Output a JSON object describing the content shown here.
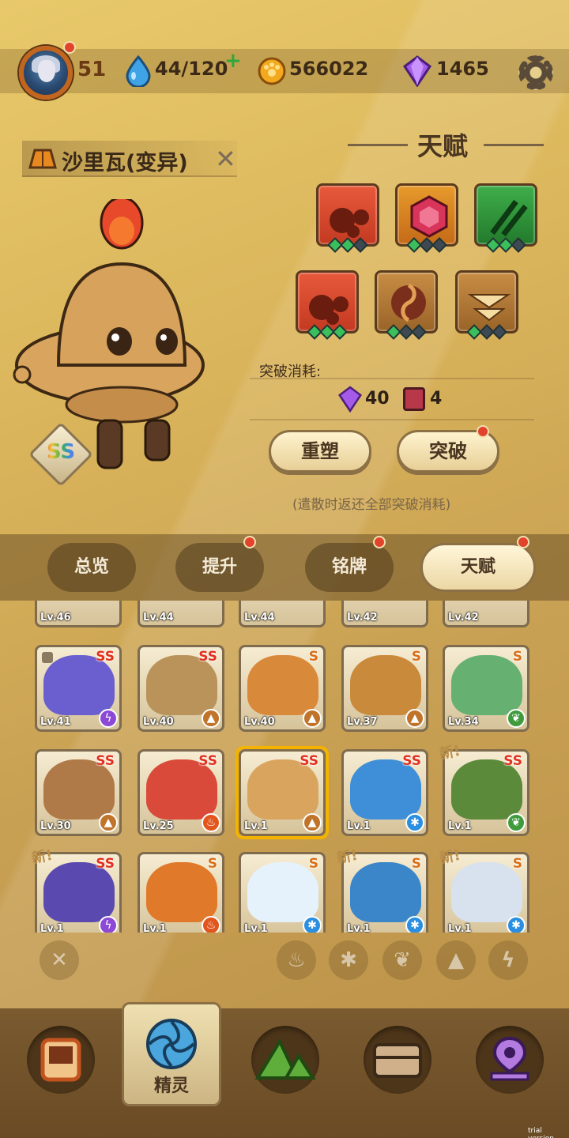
{
  "status": {
    "level": "51",
    "stamina": "44/120",
    "coins": "566022",
    "gems": "1465"
  },
  "spirit": {
    "name": "沙里瓦(变异)",
    "rank": "SS"
  },
  "talent": {
    "title": "天赋",
    "break_cost_label": "突破消耗:",
    "cost_gems": "40",
    "cost_items": "4",
    "reshape_label": "重塑",
    "breakthrough_label": "突破",
    "note": "(遣散时返还全部突破消耗)"
  },
  "tabs": [
    "总览",
    "提升",
    "铭牌",
    "天赋"
  ],
  "cards": [
    {
      "lv": "Lv.41",
      "rank": "SS",
      "element": "thunder"
    },
    {
      "lv": "Lv.40",
      "rank": "SS",
      "element": "earth"
    },
    {
      "lv": "Lv.40",
      "rank": "S",
      "element": "earth"
    },
    {
      "lv": "Lv.37",
      "rank": "S",
      "element": "earth"
    },
    {
      "lv": "Lv.34",
      "rank": "S",
      "element": "wind"
    },
    {
      "lv": "Lv.30",
      "rank": "SS",
      "element": "earth"
    },
    {
      "lv": "Lv.25",
      "rank": "SS",
      "element": "fire"
    },
    {
      "lv": "Lv.1",
      "rank": "SS",
      "element": "earth"
    },
    {
      "lv": "Lv.1",
      "rank": "SS",
      "element": "water"
    },
    {
      "lv": "Lv.1",
      "rank": "SS",
      "element": "wind"
    },
    {
      "lv": "Lv.1",
      "rank": "SS",
      "element": "thunder"
    },
    {
      "lv": "Lv.1",
      "rank": "S",
      "element": "fire"
    },
    {
      "lv": "Lv.1",
      "rank": "S",
      "element": "water"
    },
    {
      "lv": "Lv.1",
      "rank": "S",
      "element": "water"
    },
    {
      "lv": "Lv.1",
      "rank": "S",
      "element": "water"
    }
  ],
  "top_partial_levels": [
    "Lv.46",
    "Lv.44",
    "Lv.44",
    "Lv.42",
    "Lv.42"
  ],
  "new_tag": "新!",
  "nav": {
    "active_label": "精灵"
  },
  "watermark": "trial version",
  "colors": {
    "fire": "#e2561d",
    "water": "#2a8fe0",
    "earth": "#c0742a",
    "wind": "#3f9b3c",
    "thunder": "#8c49d6"
  }
}
